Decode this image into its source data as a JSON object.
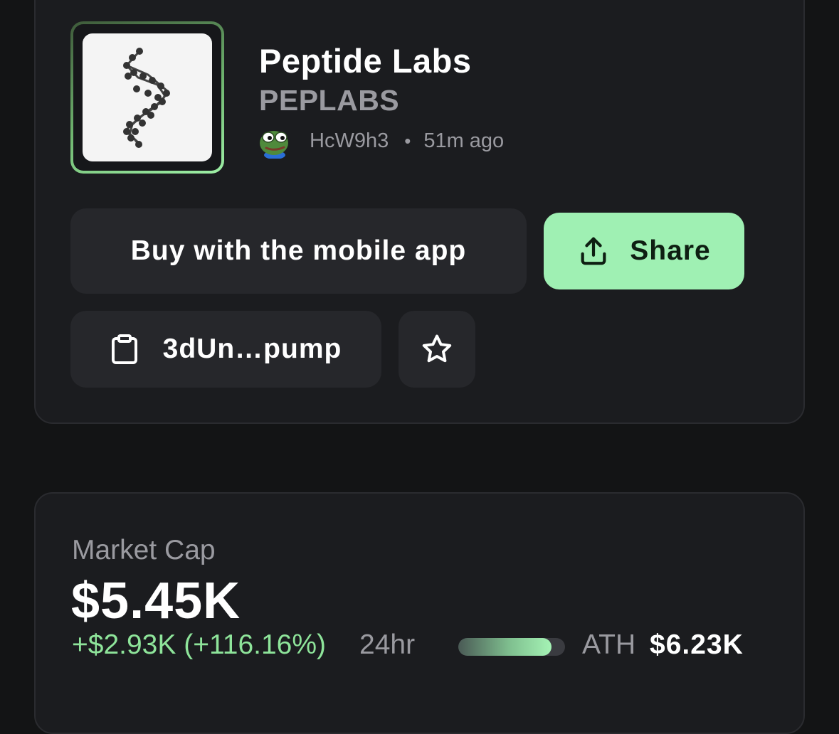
{
  "token": {
    "name": "Peptide Labs",
    "ticker": "PEPLABS",
    "creator": "HcW9h3",
    "separator": "•",
    "age": "51m ago",
    "logo_icon": "dna-helix-icon",
    "creator_avatar_icon": "pepe-frog-avatar"
  },
  "actions": {
    "buy_label": "Buy with the mobile app",
    "share_label": "Share",
    "contract_label": "3dUn…pump"
  },
  "market": {
    "label": "Market Cap",
    "value": "$5.45K",
    "change": "+$2.93K (+116.16%)",
    "period": "24hr",
    "ath_label": "ATH",
    "ath_value": "$6.23K",
    "ath_progress_fraction": 0.87
  },
  "colors": {
    "background": "#131415",
    "card": "#1b1c1f",
    "accent_green": "#9ff0b3",
    "positive_text": "#8ee49a",
    "muted_text": "#9a9aa0"
  }
}
